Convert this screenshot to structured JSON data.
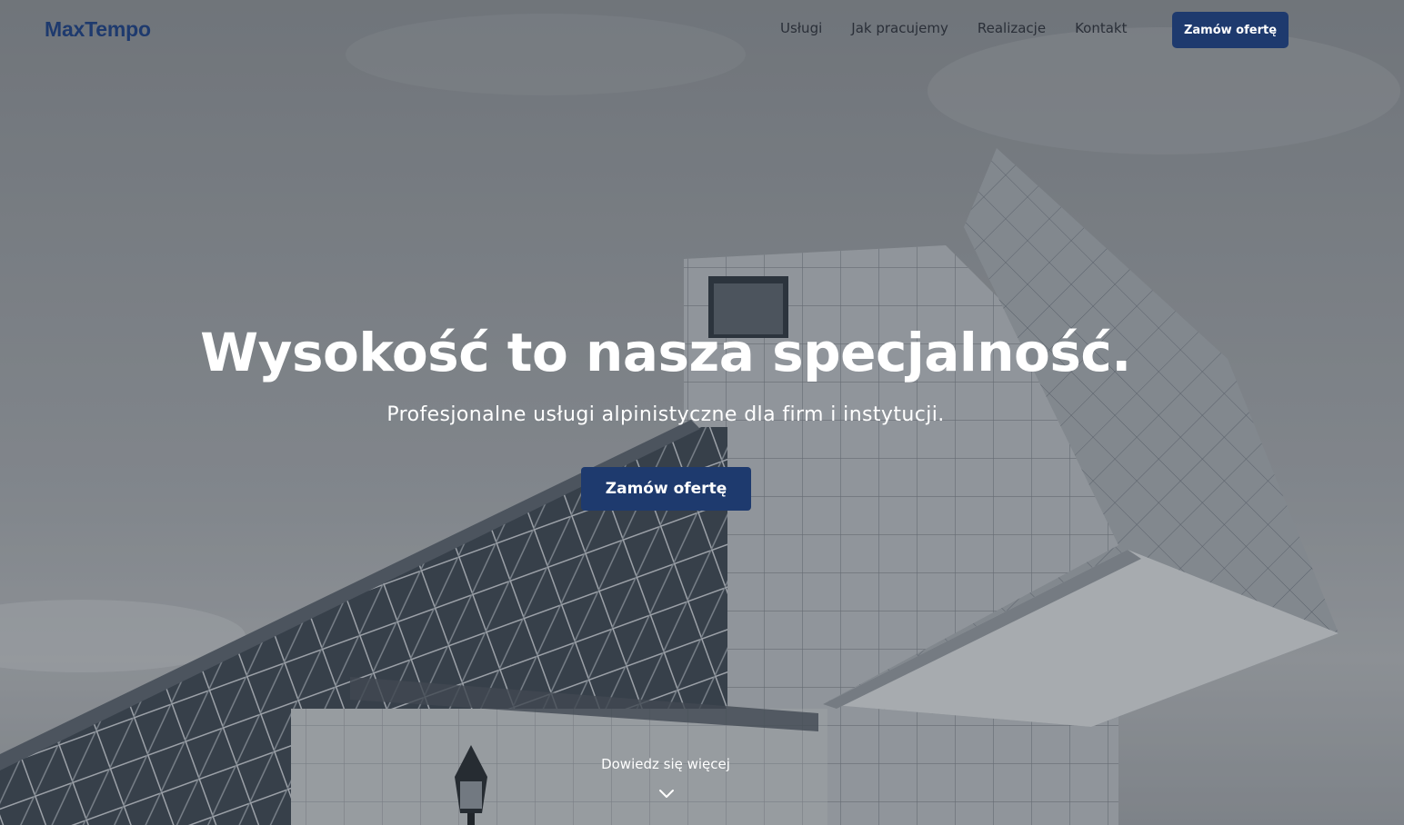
{
  "brand": {
    "logo": "MaxTempo"
  },
  "nav": {
    "links": [
      "Usługi",
      "Jak pracujemy",
      "Realizacje",
      "Kontakt"
    ],
    "cta_label": "Zamów ofertę"
  },
  "hero": {
    "title": "Wysokość to nasza specjalność.",
    "subtitle": "Profesjonalne usługi alpinistyczne dla firm i instytucji.",
    "cta_label": "Zamów ofertę",
    "learn_more": "Dowiedz się więcej",
    "scroll_icon": "chevron-down-icon"
  },
  "colors": {
    "brand_navy": "#1e3a6e",
    "text_white": "#ffffff",
    "nav_text": "#2a2f38"
  }
}
